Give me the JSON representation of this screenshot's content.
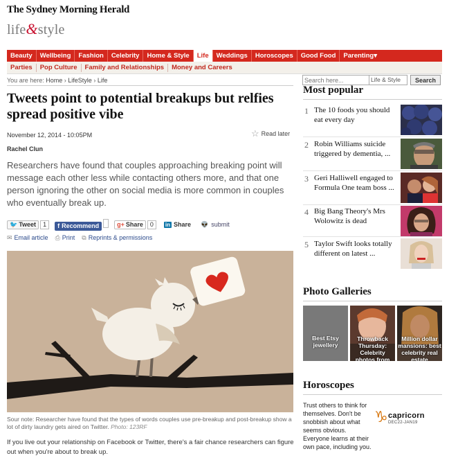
{
  "masthead": {
    "paper": "The Sydney Morning Herald",
    "section_left": "life",
    "section_amp": "&",
    "section_right": "style"
  },
  "nav": {
    "items": [
      "Beauty",
      "Wellbeing",
      "Fashion",
      "Celebrity",
      "Home & Style",
      "Life",
      "Weddings",
      "Horoscopes",
      "Good Food",
      "Parenting"
    ],
    "active": "Life",
    "dropdown_indicator": "▾"
  },
  "subnav": {
    "items": [
      "Parties",
      "Pop Culture",
      "Family and Relationships",
      "Money and Careers"
    ]
  },
  "breadcrumb": {
    "prefix": "You are here:",
    "items": [
      "Home",
      "LifeStyle",
      "Life"
    ],
    "separator": "›"
  },
  "search": {
    "placeholder": "Search here...",
    "scope": "Life & Style",
    "button": "Search"
  },
  "article": {
    "headline": "Tweets point to potential breakups but relfies spread positive vibe",
    "date": "November 12, 2014 - 10:05PM",
    "read_later": "Read later",
    "author": "Rachel Clun",
    "intro": "Researchers have found that couples approaching breaking point will message each other less while contacting others more, and that one person ignoring the other on social media is more common in couples who eventually break up.",
    "caption": "Sour note: Researcher have found that the types of words couples use pre-breakup and post-breakup show a lot of dirty laundry gets aired on Twitter.",
    "photo_credit": "Photo: 123RF",
    "body_first": "If you live out your relationship on Facebook or Twitter, there's a fair chance researchers can figure out when you're about to break up."
  },
  "social": {
    "tweet": "Tweet",
    "tweet_count": "1",
    "recommend": "Recommend",
    "recommend_count": "",
    "google_plus": "Share",
    "google_count": "0",
    "linkedin": "Share",
    "linkedin_badge": "in",
    "submit": "submit"
  },
  "actions": {
    "email": "Email article",
    "print": "Print",
    "reprints": "Reprints & permissions"
  },
  "sidebar": {
    "most_popular_title": "Most popular",
    "most_popular": [
      {
        "num": "1",
        "title": "The 10 foods you should eat every day"
      },
      {
        "num": "2",
        "title": "Robin Williams suicide triggered by dementia, ..."
      },
      {
        "num": "3",
        "title": "Geri Halliwell engaged to Formula One team boss ..."
      },
      {
        "num": "4",
        "title": "Big Bang Theory's Mrs Wolowitz is dead"
      },
      {
        "num": "5",
        "title": "Taylor Swift looks totally different on latest ..."
      }
    ],
    "galleries_title": "Photo Galleries",
    "galleries": [
      {
        "label": "Best Etsy jewellery"
      },
      {
        "label": "Throwback Thursday: Celebrity photos from"
      },
      {
        "label": "Million dollar mansions: best celebrity real estate"
      }
    ],
    "horoscopes_title": "Horoscopes",
    "horoscope_text": "Trust others to think for themselves. Don't be snobbish about what seems obvious. Everyone learns at their own pace, including you.",
    "horoscope_sign": "capricorn",
    "horoscope_dates": "DEC22-JAN19",
    "horoscope_glyph": "♑"
  },
  "colors": {
    "brand_red": "#d4281e",
    "heart": "#d8281e",
    "hero_bg": "#c9b29a"
  }
}
